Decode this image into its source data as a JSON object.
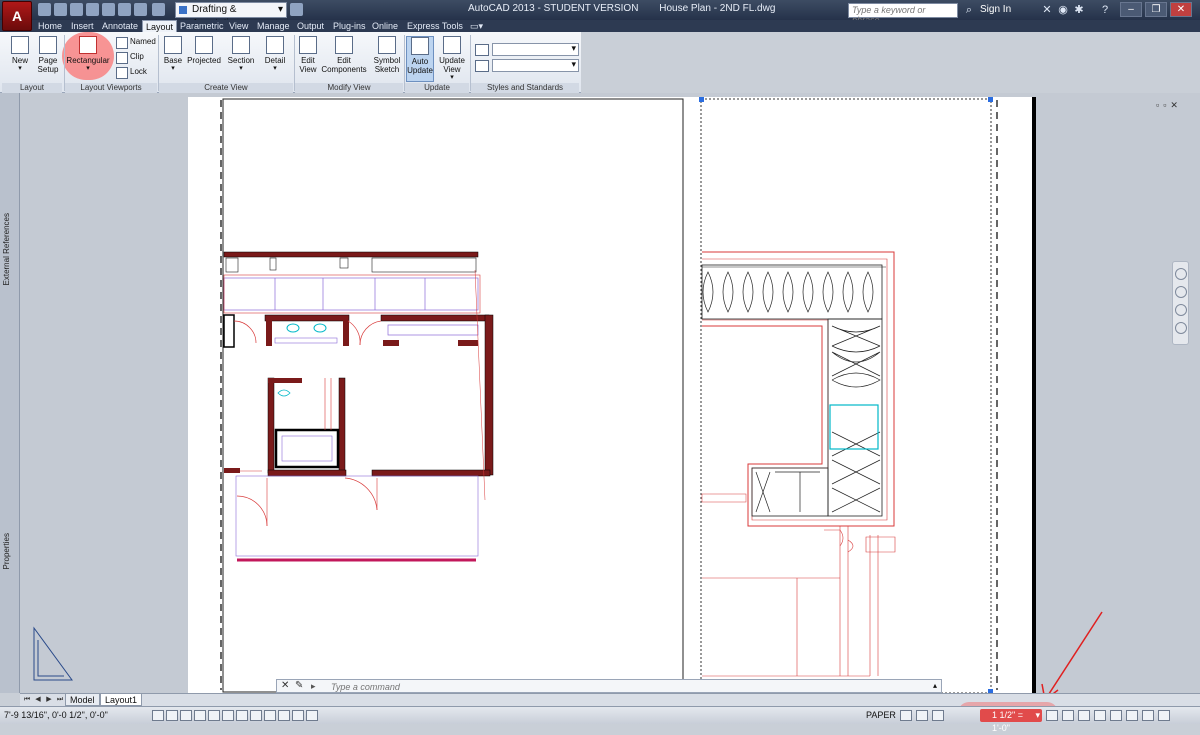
{
  "app": {
    "title": "AutoCAD 2013 - STUDENT VERSION",
    "file": "House Plan - 2ND FL.dwg",
    "workspace": "Drafting & Annotation",
    "search_placeholder": "Type a keyword or phrase",
    "sign_in": "Sign In",
    "logo_letter": "A"
  },
  "ribbon_tabs": [
    "Home",
    "Insert",
    "Annotate",
    "Layout",
    "Parametric",
    "View",
    "Manage",
    "Output",
    "Plug-ins",
    "Online",
    "Express Tools"
  ],
  "active_ribbon_tab": "Layout",
  "panels": {
    "layout": {
      "label": "Layout",
      "new": "New",
      "page_setup_1": "Page",
      "page_setup_2": "Setup"
    },
    "viewports": {
      "label": "Layout Viewports",
      "rectangular": "Rectangular",
      "named": "Named",
      "clip": "Clip",
      "lock": "Lock"
    },
    "create_view": {
      "label": "Create View",
      "base": "Base",
      "projected": "Projected",
      "section": "Section",
      "detail": "Detail"
    },
    "modify_view": {
      "label": "Modify View",
      "edit_view_1": "Edit",
      "edit_view_2": "View",
      "edit_components_1": "Edit",
      "edit_components_2": "Components",
      "symbol_sketch_1": "Symbol",
      "symbol_sketch_2": "Sketch"
    },
    "update": {
      "label": "Update",
      "auto_update_1": "Auto",
      "auto_update_2": "Update",
      "update_view_1": "Update",
      "update_view_2": "View"
    },
    "styles": {
      "label": "Styles and Standards"
    }
  },
  "side_palettes": {
    "external_references": "External References",
    "properties": "Properties"
  },
  "command_line": {
    "placeholder": "Type a command",
    "prompt": "▸"
  },
  "layout_tabs": [
    "Model",
    "Layout1"
  ],
  "active_layout_tab": "Layout1",
  "status": {
    "coords": "7'-9 13/16\", 0'-0 1/2\", 0'-0\"",
    "space": "PAPER",
    "viewport_scale": "1 1/2\" = 1'-0\""
  },
  "colors": {
    "accent_red": "#e14b4b",
    "wall_red": "#d83a3a",
    "cyan": "#00b8c8"
  }
}
